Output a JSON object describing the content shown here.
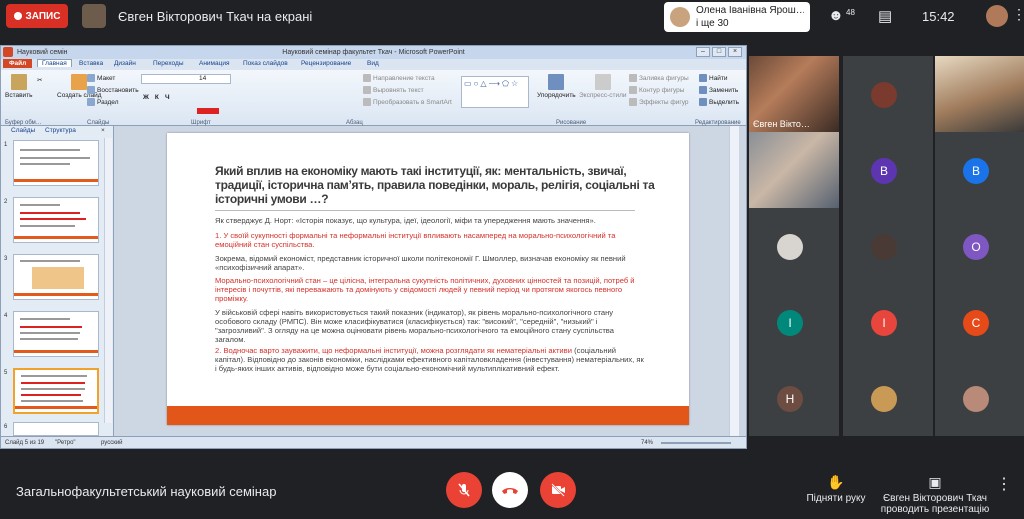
{
  "topbar": {
    "rec_label": "ЗАПИС",
    "presenter_title": "Євген Вікторович Ткач на екрані",
    "speaker_name": "Олена Іванівна Ярош…",
    "speaker_more": "і ще 30",
    "participants_count": "48",
    "time": "15:42"
  },
  "ppt": {
    "window_title": "Науковий семінар факультет Ткач - Microsoft PowerPoint",
    "doc_tab": "Науковий семін",
    "tabs": [
      "Файл",
      "Главная",
      "Вставка",
      "Дизайн",
      "Переходы",
      "Анимация",
      "Показ слайдов",
      "Рецензирование",
      "Вид"
    ],
    "groups": {
      "clipboard": "Буфер обм…",
      "slides": "Слайды",
      "font": "Шрифт",
      "paragraph": "Абзац",
      "drawing": "Рисование",
      "editing": "Редактирование"
    },
    "buttons": {
      "paste": "Вставить",
      "new_slide": "Создать слайд",
      "layout": "Макет",
      "reset": "Восстановить",
      "section": "Раздел",
      "font_size": "14",
      "text_direction": "Направление текста",
      "align_text": "Выровнять текст",
      "smartart": "Преобразовать в SmartArt",
      "arrange": "Упорядочить",
      "quick_styles": "Экспресс-стили",
      "shape_fill": "Заливка фигуры",
      "shape_outline": "Контур фигуры",
      "shape_effects": "Эффекты фигур",
      "find": "Найти",
      "replace": "Заменить",
      "select": "Выделить"
    },
    "pane_tabs": [
      "Слайды",
      "Структура"
    ],
    "thumb_numbers": [
      "1",
      "2",
      "3",
      "4",
      "5",
      "6"
    ],
    "status": {
      "slide": "Слайд 5 из 19",
      "theme": "\"Ретро\"",
      "lang": "русский",
      "zoom": "74%"
    }
  },
  "slide": {
    "title": "Який вплив на економіку мають такі інституції, як: ментальність, звичаї, традиції, історична пам’ять, правила поведінки, мораль, релігія, соціальні та історичні умови …?",
    "p1": "Як стверджує Д. Норт: «Історія показує, що культура, ідеї, ідеології, міфи та упередження мають значення».",
    "p2": "1. У своїй сукупності формальні та неформальні інституції впливають насамперед на морально-психологічний та емоційний стан суспільства.",
    "p3": "Зокрема, відомий економіст, представник історичної школи політекономії Г. Шмоллер, визначав економіку як певний «психофізичний апарат».",
    "p4": "Морально-психологічний стан – це цілісна, інтегральна сукупність політичних, духовних цінностей та позицій, потреб й інтересів і почуттів, які переважають та домінують у свідомості людей у певний період чи протягом якогось певного проміжку.",
    "p5": "У військовій сфері навіть використовується такий показник (індикатор), як рівень морально-психологічного стану особового складу (РМПС). Він може класифікуватися (класифікується) так: \"високий\", \"середній\", \"низький\" і \"загрозливий\". З огляду на це можна оцінювати рівень морально-психологічного та емоційного стану суспільства загалом.",
    "p6_red": "2. Водночас варто зауважити, що неформальні інституції, можна розглядати як нематеріальні активи",
    "p6_rest": "(соціальний капітал). Відповідно до законів економіки, наслідками ефективного капіталовкладення (інвестування) нематеріальних, як і будь-яких інших активів, відповідно може бути соціально-економічний мультиплікативний ефект."
  },
  "tiles": [
    {
      "name": "Євген Вікто…",
      "kind": "camera"
    },
    {
      "kind": "photo",
      "color": "#7a3b2e"
    },
    {
      "kind": "camera"
    },
    {
      "kind": "camera"
    },
    {
      "letter": "В",
      "color": "#5e35b1"
    },
    {
      "letter": "В",
      "color": "#1a73e8"
    },
    {
      "kind": "photo",
      "color": "#d8d4d0"
    },
    {
      "kind": "photo",
      "color": "#4a3a35"
    },
    {
      "letter": "О",
      "color": "#7e57c2"
    },
    {
      "letter": "І",
      "color": "#00897b"
    },
    {
      "letter": "І",
      "color": "#e8453c"
    },
    {
      "letter": "С",
      "color": "#e64a19"
    },
    {
      "letter": "Н",
      "color": "#6d4c41"
    },
    {
      "kind": "photo",
      "color": "#c89a55"
    },
    {
      "kind": "photo",
      "color": "#b98a78"
    }
  ],
  "bottom": {
    "meeting_name": "Загальнофакультетський науковий семінар",
    "raise_hand": "Підняти руку",
    "presenting_name": "Євген Вікторович Ткач",
    "presenting_label": "проводить презентацію"
  }
}
